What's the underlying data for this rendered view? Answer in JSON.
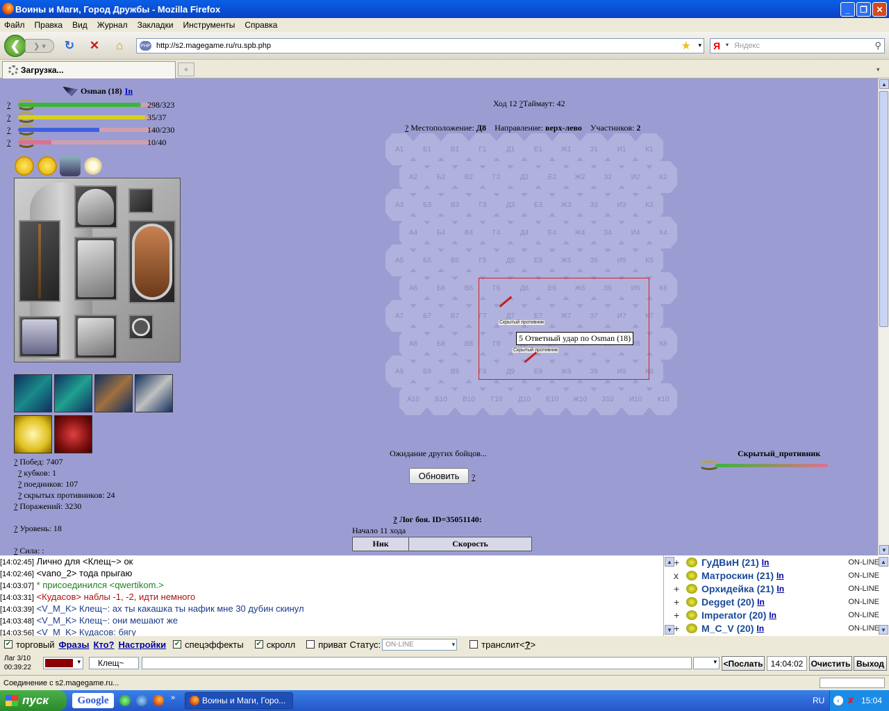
{
  "window": {
    "title": "Воины и Маги, Город Дружбы - Mozilla Firefox"
  },
  "menu": [
    "Файл",
    "Правка",
    "Вид",
    "Журнал",
    "Закладки",
    "Инструменты",
    "Справка"
  ],
  "nav": {
    "url": "http://s2.magegame.ru/ru.spb.php",
    "search_placeholder": "Яндекс",
    "search_brand": "Я"
  },
  "tab": {
    "title": "Загрузка..."
  },
  "player": {
    "name": "Osman (18)",
    "status_link": "In",
    "stats": [
      {
        "value": "298/323",
        "color": "#3cb43c",
        "fill": 0.92
      },
      {
        "value": "35/37",
        "color": "#d8d020",
        "fill": 0.95
      },
      {
        "value": "140/230",
        "color": "#4060e0",
        "fill": 0.61
      },
      {
        "value": "10/40",
        "color": "#e07090",
        "fill": 0.25
      }
    ]
  },
  "battle": {
    "turn_label": "Ход 12",
    "timeout_label": "Таймаут: 42",
    "location_label": "Местоположение:",
    "location": "Д8",
    "direction_label": "Направление:",
    "direction": "верх-лево",
    "participants_label": "Участников:",
    "participants": "2",
    "tooltip": "5 Ответный удар по Osman (18)",
    "unit_label": "Скрытый противник",
    "waiting": "Ожидание других бойцов...",
    "refresh": "Обновить",
    "enemy_name": "Скрытый_противник",
    "log_title": "Лог боя. ID=35051140:",
    "log_start": "Начало 11 хода",
    "log_headers": [
      "Ник",
      "Скорость"
    ]
  },
  "hexrows": [
    [
      "А1",
      "Б1",
      "В1",
      "Г1",
      "Д1",
      "Е1",
      "Ж1",
      "З1",
      "И1",
      "К1"
    ],
    [
      "А2",
      "Б2",
      "В2",
      "Г2",
      "Д2",
      "Е2",
      "Ж2",
      "З2",
      "И2",
      "К2"
    ],
    [
      "А3",
      "Б3",
      "В3",
      "Г3",
      "Д3",
      "Е3",
      "Ж3",
      "З3",
      "И3",
      "К3"
    ],
    [
      "А4",
      "Б4",
      "В4",
      "Г4",
      "Д4",
      "Е4",
      "Ж4",
      "З4",
      "И4",
      "К4"
    ],
    [
      "А5",
      "Б5",
      "В5",
      "Г5",
      "Д5",
      "Е5",
      "Ж5",
      "З5",
      "И5",
      "К5"
    ],
    [
      "А6",
      "Б6",
      "В6",
      "Г6",
      "Д6",
      "Е6",
      "Ж6",
      "З6",
      "И6",
      "К6"
    ],
    [
      "А7",
      "Б7",
      "В7",
      "Г7",
      "Д7",
      "Е7",
      "Ж7",
      "З7",
      "И7",
      "К7"
    ],
    [
      "А8",
      "Б8",
      "В8",
      "Г8",
      "Д8",
      "Е8",
      "Ж8",
      "З8",
      "И8",
      "К8"
    ],
    [
      "А9",
      "Б9",
      "В9",
      "Г9",
      "Д9",
      "Е9",
      "Ж9",
      "З9",
      "И9",
      "К9"
    ],
    [
      "А10",
      "Б10",
      "В10",
      "Г10",
      "Д10",
      "Е10",
      "Ж10",
      "З10",
      "И10",
      "К10"
    ]
  ],
  "records": {
    "wins": "Побед: 7407",
    "cups": "кубков: 1",
    "duels": "поединков: 107",
    "hidden": "скрытых противников: 24",
    "losses": "Поражений: 3230",
    "level": "Уровень: 18",
    "strength": "Сила: :"
  },
  "chat": [
    {
      "time": "[14:02:45]",
      "text": "Лично для <Клещ~> ок"
    },
    {
      "time": "[14:02:46]",
      "text": "<vano_2> тода прыгаю"
    },
    {
      "time": "[14:03:07]",
      "text": "* присоединился <qwertikom.>"
    },
    {
      "time": "[14:03:31]",
      "text": "<Кудасов> наблы -1, -2, идти немного"
    },
    {
      "time": "[14:03:39]",
      "text": "<V_M_K> Клещ~: ах ты какашка ты нафик мне 30 дубин скинул"
    },
    {
      "time": "[14:03:48]",
      "text": "<V_M_K> Клещ~: они мешают же"
    },
    {
      "time": "[14:03:56]",
      "text": "<V_M_K> Кудасов: бягу"
    }
  ],
  "users": [
    {
      "mark": "+",
      "name": "ГуДВиН (21)",
      "link": "In",
      "status": "ON-LINE"
    },
    {
      "mark": "x",
      "name": "Матроскин (21)",
      "link": "In",
      "status": "ON-LINE"
    },
    {
      "mark": "+",
      "name": "Орхидейка (21)",
      "link": "In",
      "status": "ON-LINE"
    },
    {
      "mark": "+",
      "name": "Degget (20)",
      "link": "In",
      "status": "ON-LINE"
    },
    {
      "mark": "+",
      "name": "Imperator (20)",
      "link": "In",
      "status": "ON-LINE"
    },
    {
      "mark": "+",
      "name": "M_C_V (20)",
      "link": "In",
      "status": "ON-LINE"
    }
  ],
  "controls": {
    "trade": "торговый",
    "phrases": "Фразы",
    "who": "Кто?",
    "settings": "Настройки",
    "effects": "спецэффекты",
    "scroll": "скролл",
    "private": "приват",
    "status_label": "Статус:",
    "status_value": "ON-LINE",
    "translit": "транслит<",
    "translit_q": "?",
    "translit_end": ">"
  },
  "inputrow": {
    "lag": "Лаг 3/10",
    "timer": "00:39:22",
    "to": "Клещ~",
    "send": "<Послать",
    "time": "14:04:02",
    "clear": "Очистить",
    "exit": "Выход"
  },
  "statusbar": "Соединение с s2.magegame.ru...",
  "taskbar": {
    "start": "пуск",
    "google": "Google",
    "task": "Воины и Маги, Горо...",
    "lang": "RU",
    "clock": "15:04"
  }
}
